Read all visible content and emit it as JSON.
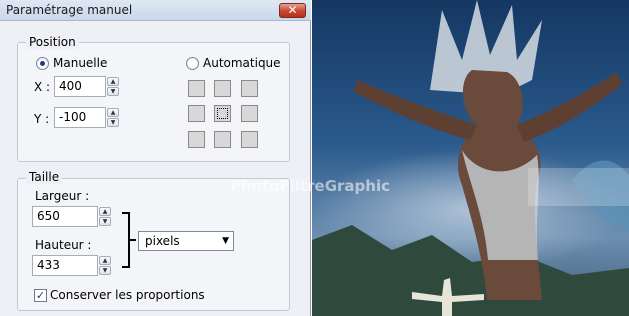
{
  "window": {
    "title": "Paramétrage manuel",
    "close_glyph": "✕"
  },
  "position": {
    "label": "Position",
    "manual_label": "Manuelle",
    "auto_label": "Automatique",
    "mode": "Manuelle",
    "x_label": "X :",
    "x_value": "400",
    "y_label": "Y :",
    "y_value": "-100",
    "anchor_selected": "center"
  },
  "size": {
    "label": "Taille",
    "width_label": "Largeur :",
    "width_value": "650",
    "height_label": "Hauteur :",
    "height_value": "433",
    "unit": "pixels",
    "keep_ratio_label": "Conserver les proportions",
    "keep_ratio_checked": true
  },
  "preview": {
    "watermark": "PhotoFiltreGraphic",
    "description_colors": {
      "sky": "#1d4576",
      "haze": "#8fa9c3"
    }
  },
  "icons": {
    "close": "close-icon",
    "spin_up": "spin-up-icon",
    "spin_down": "spin-down-icon",
    "dropdown": "chevron-down-icon",
    "checkmark": "checkmark-icon"
  }
}
